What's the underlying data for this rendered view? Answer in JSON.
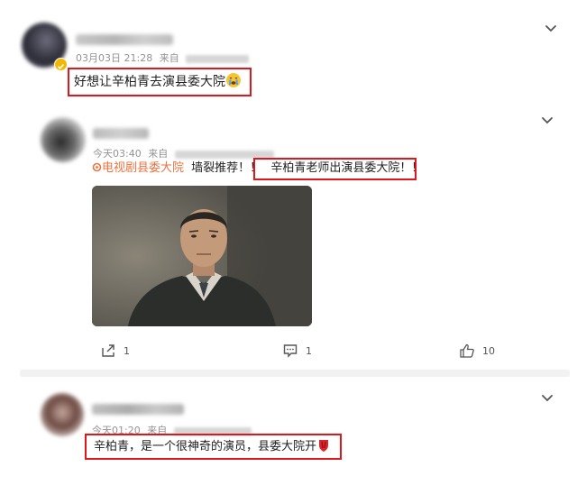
{
  "comments": [
    {
      "timestamp": "03月03日 21:28",
      "source_prefix": "来自",
      "text": "好想让辛柏青去演县委大院",
      "emoji_icon": "crying-face-emoji"
    },
    {
      "timestamp": "今天03:40",
      "source_prefix": "来自",
      "hashtag": "电视剧县委大院",
      "text_plain": "墙裂推荐！！",
      "text_highlight": "辛柏青老师出演县委大院！！",
      "image_label": "actor-photo",
      "actions": {
        "share_count": "1",
        "comment_count": "1",
        "like_count": "10"
      }
    },
    {
      "timestamp": "今天01:20",
      "source_prefix": "来自",
      "text": "辛柏青，是一个很神奇的演员，县委大院开",
      "emoji_icon": "red-shield-emoji"
    }
  ],
  "colors": {
    "highlight_box": "#e0161b",
    "hashtag": "#eb7340",
    "meta_text": "#939393"
  }
}
